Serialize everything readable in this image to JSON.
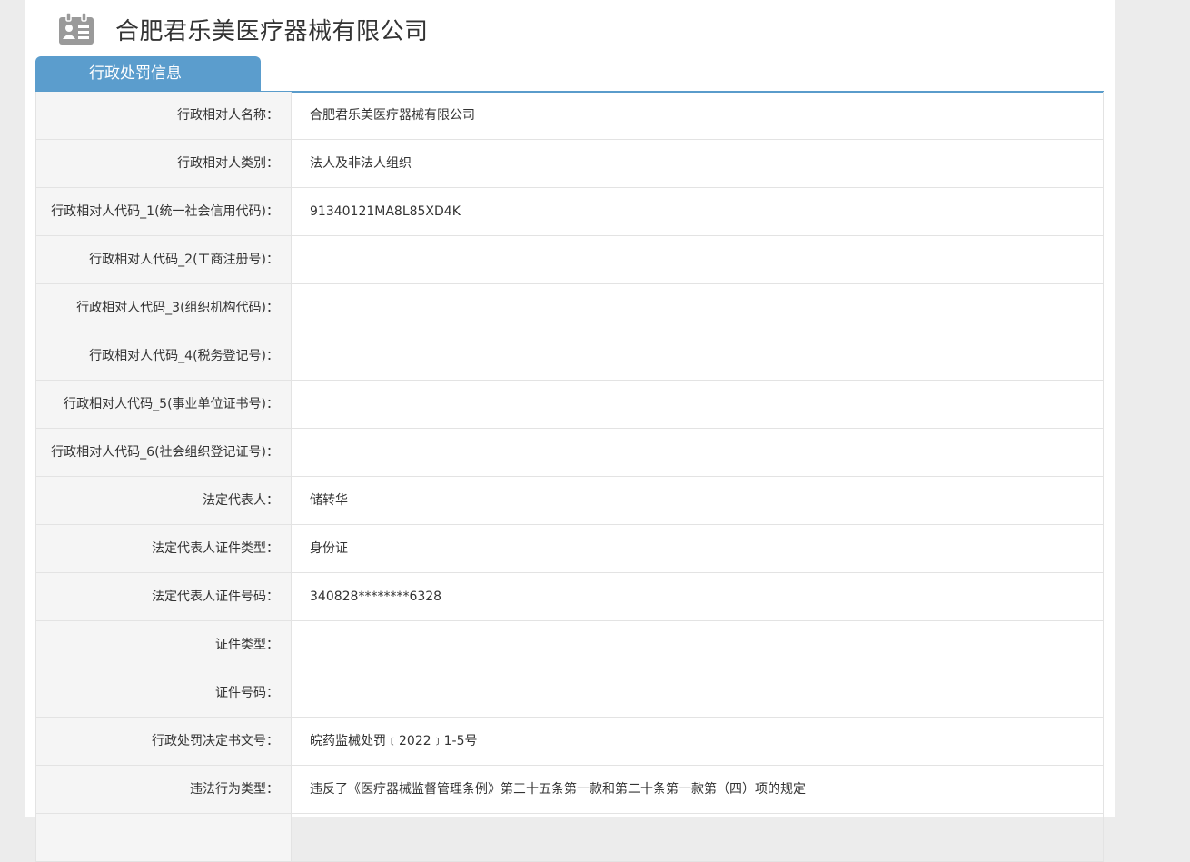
{
  "header": {
    "company_name": "合肥君乐美医疗器械有限公司",
    "icon": "contact-card-icon"
  },
  "tab": {
    "label": "行政处罚信息"
  },
  "colors": {
    "tab_bg": "#5b9dcd",
    "label_bg": "#f5f5f5",
    "border": "#e3e3e3"
  },
  "rows": [
    {
      "label": "行政相对人名称：",
      "value": "合肥君乐美医疗器械有限公司"
    },
    {
      "label": "行政相对人类别：",
      "value": "法人及非法人组织"
    },
    {
      "label": "行政相对人代码_1(统一社会信用代码)：",
      "value": "91340121MA8L85XD4K"
    },
    {
      "label": "行政相对人代码_2(工商注册号)：",
      "value": ""
    },
    {
      "label": "行政相对人代码_3(组织机构代码)：",
      "value": ""
    },
    {
      "label": "行政相对人代码_4(税务登记号)：",
      "value": ""
    },
    {
      "label": "行政相对人代码_5(事业单位证书号)：",
      "value": ""
    },
    {
      "label": "行政相对人代码_6(社会组织登记证号)：",
      "value": ""
    },
    {
      "label": "法定代表人：",
      "value": "储转华"
    },
    {
      "label": "法定代表人证件类型：",
      "value": "身份证"
    },
    {
      "label": "法定代表人证件号码：",
      "value": "340828********6328"
    },
    {
      "label": "证件类型：",
      "value": ""
    },
    {
      "label": "证件号码：",
      "value": ""
    },
    {
      "label": "行政处罚决定书文号：",
      "value": "皖药监械处罚﹝2022﹞1-5号"
    },
    {
      "label": "违法行为类型：",
      "value": "违反了《医疗器械监督管理条例》第三十五条第一款和第二十条第一款第（四）项的规定"
    },
    {
      "label": "",
      "value": ""
    }
  ]
}
